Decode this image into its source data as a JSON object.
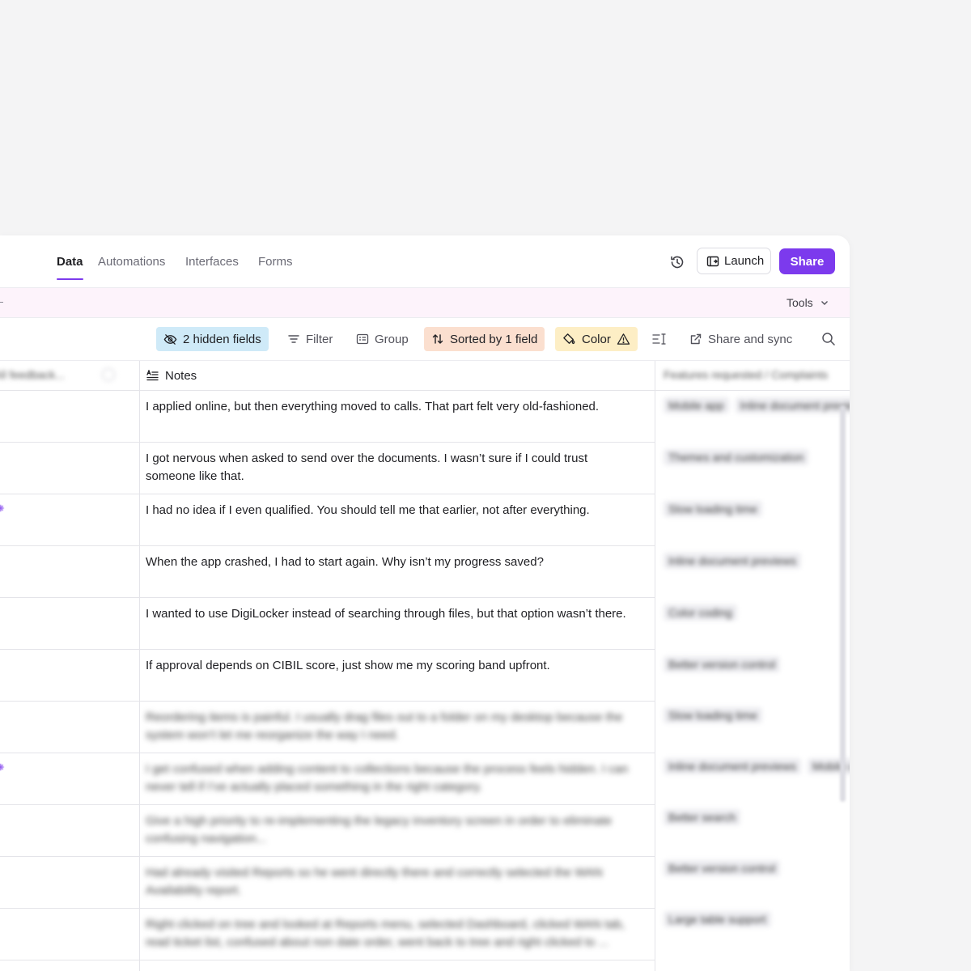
{
  "nav": {
    "tabs": [
      {
        "label": "Data",
        "active": true
      },
      {
        "label": "Automations",
        "active": false
      },
      {
        "label": "Interfaces",
        "active": false
      },
      {
        "label": "Forms",
        "active": false
      }
    ],
    "launch_label": "Launch",
    "share_label": "Share",
    "history_icon": "history-icon"
  },
  "band": {
    "tools_label": "Tools"
  },
  "toolbar": {
    "hidden_fields": "2 hidden fields",
    "filter": "Filter",
    "group": "Group",
    "sorted": "Sorted by 1 field",
    "color": "Color",
    "share_sync": "Share and sync"
  },
  "grid": {
    "left_header": "All feedback...",
    "notes_header": "Notes",
    "right_header": "Features requested / Complaints",
    "rows": [
      {
        "note": "I applied online, but then everything moved to calls. That part felt very old-fashioned.",
        "features": [
          "Mobile app",
          "Inline document previews"
        ],
        "sparkle": false,
        "blurred": false
      },
      {
        "note": "I got nervous when asked to send over the documents. I wasn’t sure if I could trust someone like that.",
        "features": [
          "Themes and customization"
        ],
        "sparkle": false,
        "blurred": false
      },
      {
        "note": "I had no idea if I even qualified. You should tell me that earlier, not after everything.",
        "features": [
          "Slow loading time"
        ],
        "sparkle": true,
        "blurred": false
      },
      {
        "note": "When the app crashed, I had to start again. Why isn’t my progress saved?",
        "features": [
          "Inline document previews"
        ],
        "sparkle": false,
        "blurred": false
      },
      {
        "note": "I wanted to use DigiLocker instead of searching through files, but that option wasn’t there.",
        "features": [
          "Color coding"
        ],
        "sparkle": false,
        "blurred": false
      },
      {
        "note": "If approval depends on CIBIL score, just show me my scoring band upfront.",
        "features": [
          "Better version control"
        ],
        "sparkle": false,
        "blurred": false
      },
      {
        "note": "Reordering items is painful. I usually drag files out to a folder on my desktop because the system won’t let me reorganize the way I need.",
        "features": [
          "Slow loading time"
        ],
        "sparkle": false,
        "blurred": true
      },
      {
        "note": "I get confused when adding content to collections because the process feels hidden. I can never tell if I’ve actually placed something in the right category.",
        "features": [
          "Inline document previews",
          "Mobile app"
        ],
        "sparkle": true,
        "blurred": true
      },
      {
        "note": "Give a high priority to re-implementing the legacy inventory screen in order to eliminate confusing navigation...",
        "features": [
          "Better search"
        ],
        "sparkle": false,
        "blurred": true
      },
      {
        "note": "Had already visited Reports so he went directly there and correctly selected the WAN Availability report.",
        "features": [
          "Better version control"
        ],
        "sparkle": false,
        "blurred": true
      },
      {
        "note": "Right clicked on tree and looked at Reports menu, selected Dashboard, clicked WAN tab, read ticket list, confused about non date order, went back to tree and right clicked to ...",
        "features": [
          "Large table support"
        ],
        "sparkle": false,
        "blurred": true
      }
    ]
  },
  "colors": {
    "accent": "#7c3aed",
    "band": "#fdf3fb"
  }
}
